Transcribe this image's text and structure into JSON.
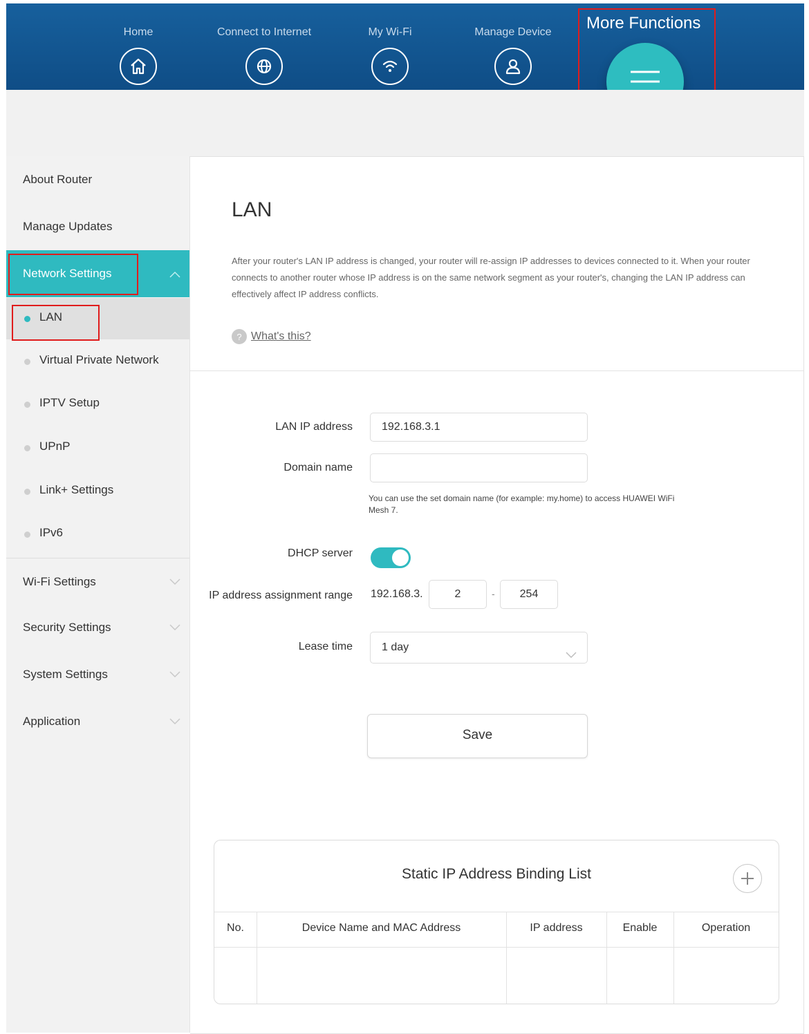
{
  "nav": {
    "items": [
      {
        "label": "Home",
        "icon": "home-icon"
      },
      {
        "label": "Connect to Internet",
        "icon": "globe-icon"
      },
      {
        "label": "My Wi-Fi",
        "icon": "wifi-icon"
      },
      {
        "label": "Manage Device",
        "icon": "user-icon"
      }
    ],
    "more_label": "More Functions",
    "more_icon": "menu-icon"
  },
  "sidebar": {
    "about": "About Router",
    "updates": "Manage Updates",
    "network": "Network Settings",
    "sub": [
      "LAN",
      "Virtual Private Network",
      "IPTV Setup",
      "UPnP",
      "Link+ Settings",
      "IPv6"
    ],
    "groups": [
      "Wi-Fi Settings",
      "Security Settings",
      "System Settings",
      "Application"
    ]
  },
  "page": {
    "title": "LAN",
    "description": "After your router's LAN IP address is changed, your router will re-assign IP addresses to devices connected to it. When your router connects to another router whose IP address is on the same network segment as your router's, changing the LAN IP address can effectively affect IP address conflicts.",
    "help_link": "What's this?"
  },
  "form": {
    "lan_ip_label": "LAN IP address",
    "lan_ip_value": "192.168.3.1",
    "domain_label": "Domain name",
    "domain_value": "",
    "domain_hint": "You can use the set domain name (for example: my.home) to access HUAWEI WiFi Mesh 7.",
    "dhcp_label": "DHCP server",
    "dhcp_enabled": true,
    "range_label": "IP address assignment range",
    "range_prefix": "192.168.3.",
    "range_start": "2",
    "range_dash": "-",
    "range_end": "254",
    "lease_label": "Lease time",
    "lease_value": "1 day",
    "save_label": "Save"
  },
  "binding_table": {
    "title": "Static IP Address Binding List",
    "columns": [
      "No.",
      "Device Name and MAC Address",
      "IP address",
      "Enable",
      "Operation"
    ],
    "rows": []
  },
  "colors": {
    "header_blue": "#0f4d86",
    "accent_teal": "#2fbac0",
    "highlight_red": "#e01c1c"
  }
}
